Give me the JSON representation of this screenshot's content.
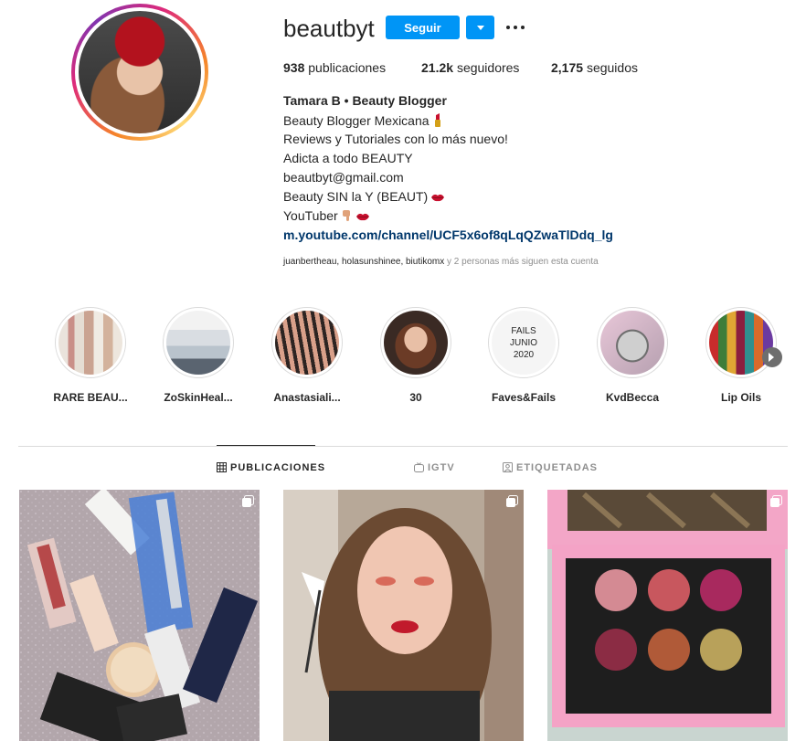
{
  "profile": {
    "username": "beautbyt",
    "follow_label": "Seguir",
    "stats": {
      "posts_count": "938",
      "posts_label": "publicaciones",
      "followers_count": "21.2k",
      "followers_label": "seguidores",
      "following_count": "2,175",
      "following_label": "seguidos"
    },
    "bio": {
      "name": "Tamara B • Beauty Blogger",
      "line1": "Beauty Blogger Mexicana",
      "line2": "Reviews y Tutoriales con lo más nuevo!",
      "line3": "Adicta a todo BEAUTY",
      "line4": "beautbyt@gmail.com",
      "line5": "Beauty SIN la Y (BEAUT)",
      "line6": "YouTuber",
      "link": "m.youtube.com/channel/UCF5x6of8qLqQZwaTlDdq_lg"
    },
    "followed_by_names": "juanbertheau, holasunshinee, biutikomx",
    "followed_by_suffix": "y 2 personas más siguen esta cuenta"
  },
  "highlights": [
    {
      "label": "RARE BEAU..."
    },
    {
      "label": "ZoSkinHeal..."
    },
    {
      "label": "Anastasiali..."
    },
    {
      "label": "30"
    },
    {
      "label": "Faves&Fails"
    },
    {
      "label": "KvdBecca"
    },
    {
      "label": "Lip Oils"
    }
  ],
  "highlight_thumb_text": {
    "faves": [
      "FAILS",
      "JUNIO",
      "2020"
    ]
  },
  "tabs": {
    "posts": "PUBLICACIONES",
    "igtv": "IGTV",
    "tagged": "ETIQUETADAS"
  },
  "icons": {
    "more": "more-horizontal-icon",
    "dropdown": "chevron-down-icon",
    "grid": "grid-icon",
    "igtv": "igtv-icon",
    "tagged": "tagged-icon",
    "carousel": "carousel-icon"
  },
  "colors": {
    "accent": "#0095f6",
    "link": "#00376b",
    "muted": "#8e8e8e"
  }
}
